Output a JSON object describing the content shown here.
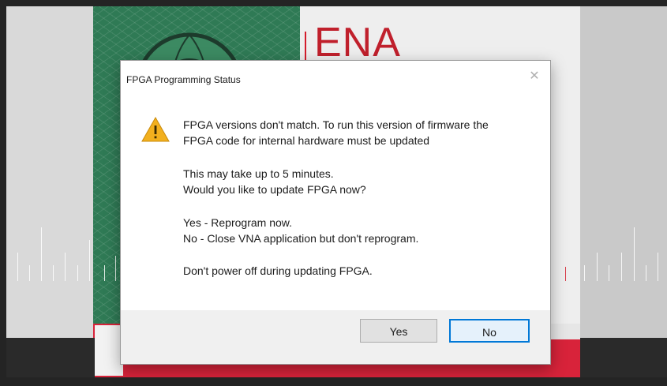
{
  "background": {
    "logo_text": "ENA",
    "colors": {
      "green_panel": "#2f7a55",
      "brand_red": "#d41c2c"
    }
  },
  "dialog": {
    "title": "FPGA Programming Status",
    "close_icon": "close-icon",
    "warning_icon": "warning-icon",
    "message": {
      "line1": "FPGA versions don't match. To run this version of firmware the",
      "line2": "FPGA code for internal hardware must be updated",
      "line3": "This may take up to 5 minutes.",
      "line4": "Would you like to update FPGA now?",
      "line5": "Yes - Reprogram now.",
      "line6": "No  - Close VNA application but don't reprogram.",
      "line7": "Don't power off during updating FPGA."
    },
    "buttons": {
      "yes": "Yes",
      "no": "No"
    },
    "colors": {
      "focus_border": "#0078d7",
      "warning_fill": "#f2b01e"
    }
  }
}
